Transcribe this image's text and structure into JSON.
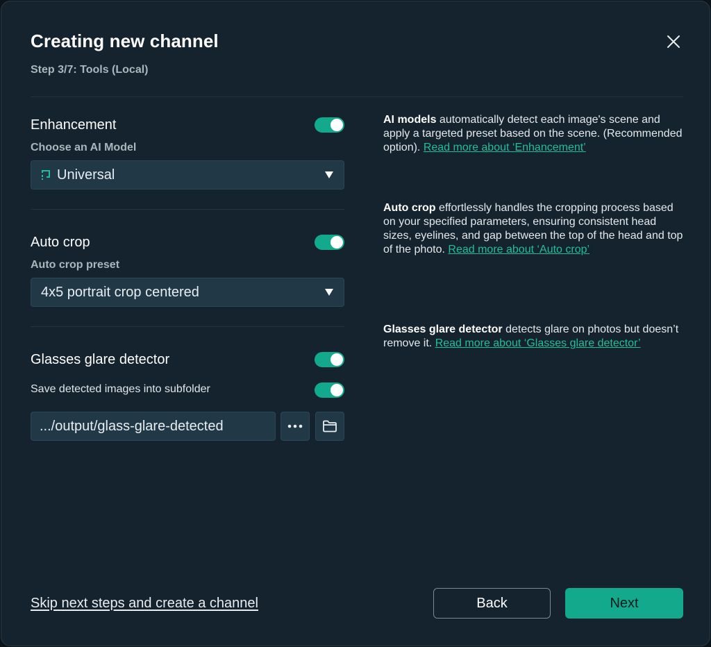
{
  "dialog": {
    "title": "Creating new channel",
    "step": "Step 3/7: Tools (Local)"
  },
  "enhancement": {
    "title": "Enhancement",
    "enabled": true,
    "model_label": "Choose an AI Model",
    "model_value": "Universal",
    "desc_bold": "AI models",
    "desc_text": " automatically detect each image's scene and apply a targeted preset based on the scene. (Recommended option). ",
    "desc_link": "Read more about ‘Enhancement’"
  },
  "auto_crop": {
    "title": "Auto crop",
    "enabled": true,
    "preset_label": "Auto crop preset",
    "preset_value": "4x5 portrait crop centered",
    "desc_bold": "Auto crop",
    "desc_text": " effortlessly handles the cropping process based on your specified parameters, ensuring consistent head sizes, eyelines, and gap between the top of the head and top of the photo. ",
    "desc_link": "Read more about ‘Auto crop’"
  },
  "glare": {
    "title": "Glasses glare detector",
    "enabled": true,
    "save_label": "Save detected images into subfolder",
    "save_enabled": true,
    "path_value": ".../output/glass-glare-detected",
    "desc_bold": "Glasses glare detector",
    "desc_text": " detects glare on photos but doesn’t remove it. ",
    "desc_link": "Read more about ‘Glasses glare detector’"
  },
  "footer": {
    "skip_link": "Skip next steps and create a channel",
    "back_label": "Back",
    "next_label": "Next"
  },
  "icons": {
    "close": "close-icon",
    "model": "ai-model-icon",
    "caret": "caret-down-icon",
    "more": "more-dots-icon",
    "folder": "folder-icon"
  },
  "colors": {
    "accent": "#13a98c",
    "link": "#1fbf9c",
    "background": "#15232e",
    "field": "#213847"
  }
}
